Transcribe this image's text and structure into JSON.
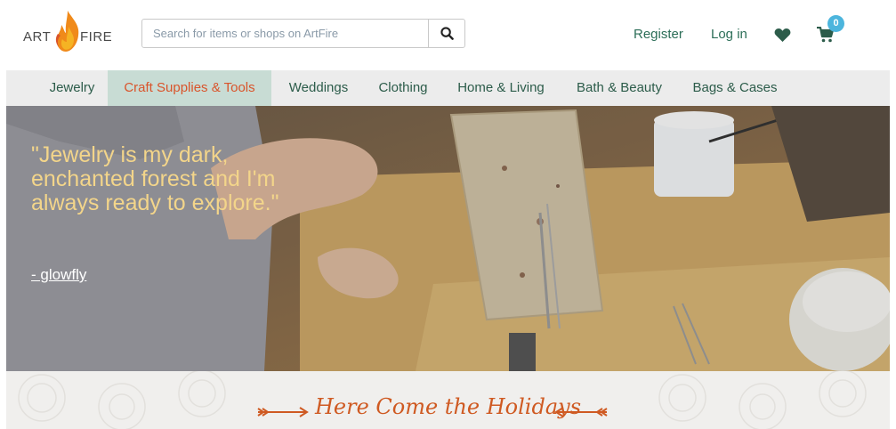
{
  "brand": {
    "left": "ART",
    "right": "FIRE"
  },
  "search": {
    "placeholder": "Search for items or shops on ArtFire"
  },
  "header_links": {
    "register": "Register",
    "login": "Log in"
  },
  "cart": {
    "count": "0"
  },
  "nav": {
    "items": [
      {
        "label": "Jewelry"
      },
      {
        "label": "Craft Supplies & Tools",
        "active": true
      },
      {
        "label": "Weddings"
      },
      {
        "label": "Clothing"
      },
      {
        "label": "Home & Living"
      },
      {
        "label": "Bath & Beauty"
      },
      {
        "label": "Bags & Cases"
      }
    ]
  },
  "hero": {
    "quote": "\"Jewelry is my dark, enchanted forest and I'm always ready to explore.\"",
    "author": "- glowfly"
  },
  "banner": {
    "title": "Here Come the Holidays"
  },
  "colors": {
    "accent": "#d9542b",
    "nav_text": "#2c5c4a",
    "badge": "#4cb5dd",
    "quote": "#f3d58a"
  },
  "icons": [
    "search-icon",
    "heart-icon",
    "cart-icon",
    "flame-logo-icon"
  ]
}
